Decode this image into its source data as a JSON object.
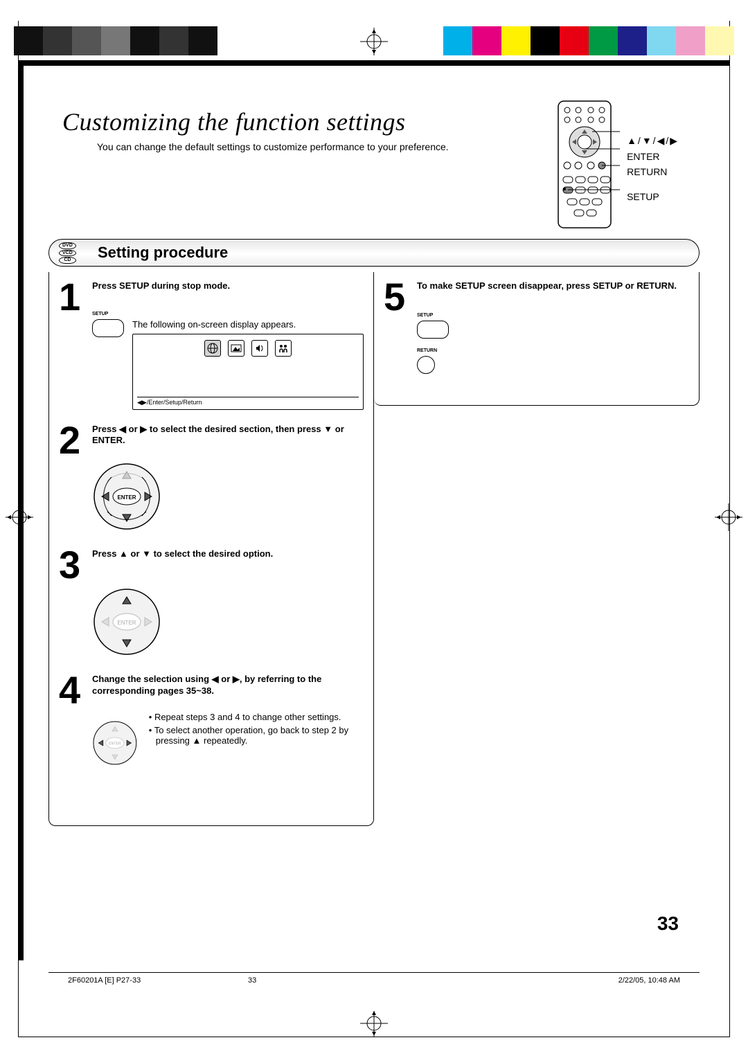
{
  "title": "Customizing the function settings",
  "subtitle": "You can change the default settings to customize performance to your preference.",
  "remote_labels": {
    "arrows": "▲/▼/◀/▶",
    "enter": "ENTER",
    "ret": "RETURN",
    "setup": "SETUP"
  },
  "discs": [
    "DVD",
    "VCD",
    "CD"
  ],
  "section_heading": "Setting procedure",
  "steps": {
    "s1": {
      "n": "1",
      "head": "Press SETUP during stop mode.",
      "desc": "The following on-screen display appears.",
      "btn_label": "SETUP",
      "osd_footer": "◀▶/Enter/Setup/Return"
    },
    "s2": {
      "n": "2",
      "head": "Press ◀ or ▶ to select the desired section, then press ▼ or ENTER."
    },
    "s3": {
      "n": "3",
      "head": "Press ▲ or ▼ to select the desired option."
    },
    "s4": {
      "n": "4",
      "head": "Change the selection using ◀ or ▶, by referring to the corresponding pages 35~38.",
      "b1": "Repeat steps 3 and 4 to change other settings.",
      "b2": "To select another operation, go back to step 2 by pressing ▲ repeatedly."
    },
    "s5": {
      "n": "5",
      "head": "To make SETUP screen disappear, press SETUP or RETURN.",
      "lbl_setup": "SETUP",
      "lbl_return": "RETURN"
    }
  },
  "page_number": "33",
  "footer": {
    "left": "2F60201A [E] P27-33",
    "mid": "33",
    "right": "2/22/05, 10:48 AM"
  },
  "dpad_enter": "ENTER"
}
